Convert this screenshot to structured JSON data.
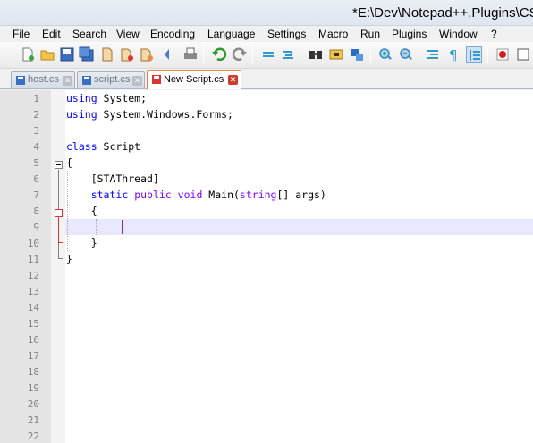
{
  "window": {
    "title": "*E:\\Dev\\Notepad++.Plugins\\CS"
  },
  "menu": [
    "File",
    "Edit",
    "Search",
    "View",
    "Encoding",
    "Language",
    "Settings",
    "Macro",
    "Run",
    "Plugins",
    "Window",
    "?"
  ],
  "toolbar": {
    "icons": [
      "new-file-icon",
      "open-file-icon",
      "save-icon",
      "save-all-icon",
      "close-icon",
      "close-all-icon",
      "print-icon",
      "undo-icon",
      "redo-icon",
      "wrap-icon",
      "sync-icon",
      "find-icon",
      "find-replace-icon",
      "zoom-in-icon",
      "zoom-out-icon",
      "indent-guide-icon",
      "show-all-chars-icon",
      "doc-map-icon",
      "record-macro-icon",
      "stop-macro-icon"
    ]
  },
  "tabs": [
    {
      "label": "host.cs",
      "active": false,
      "modified": false
    },
    {
      "label": "script.cs",
      "active": false,
      "modified": false
    },
    {
      "label": "New Script.cs",
      "active": true,
      "modified": true
    }
  ],
  "editor": {
    "lines": [
      {
        "n": "1",
        "code": "using System;"
      },
      {
        "n": "2",
        "code": "using System.Windows.Forms;"
      },
      {
        "n": "3",
        "code": ""
      },
      {
        "n": "4",
        "code": "class Script"
      },
      {
        "n": "5",
        "code": "{"
      },
      {
        "n": "6",
        "code": "    [STAThread]"
      },
      {
        "n": "7",
        "code": "    static public void Main(string[] args)"
      },
      {
        "n": "8",
        "code": "    {"
      },
      {
        "n": "9",
        "code": "        "
      },
      {
        "n": "10",
        "code": "    }"
      },
      {
        "n": "11",
        "code": "}"
      },
      {
        "n": "12",
        "code": ""
      },
      {
        "n": "13",
        "code": ""
      },
      {
        "n": "14",
        "code": ""
      },
      {
        "n": "15",
        "code": ""
      },
      {
        "n": "16",
        "code": ""
      },
      {
        "n": "17",
        "code": ""
      },
      {
        "n": "18",
        "code": ""
      },
      {
        "n": "19",
        "code": ""
      },
      {
        "n": "20",
        "code": ""
      },
      {
        "n": "21",
        "code": ""
      },
      {
        "n": "22",
        "code": ""
      }
    ],
    "current_line": "9"
  },
  "colors": {
    "keyword": "#0000ff",
    "type_keyword": "#8000ff",
    "current_line_bg": "#e8e8ff",
    "active_tab_accent": "#ee8a3a",
    "fold_active": "#e03030"
  }
}
